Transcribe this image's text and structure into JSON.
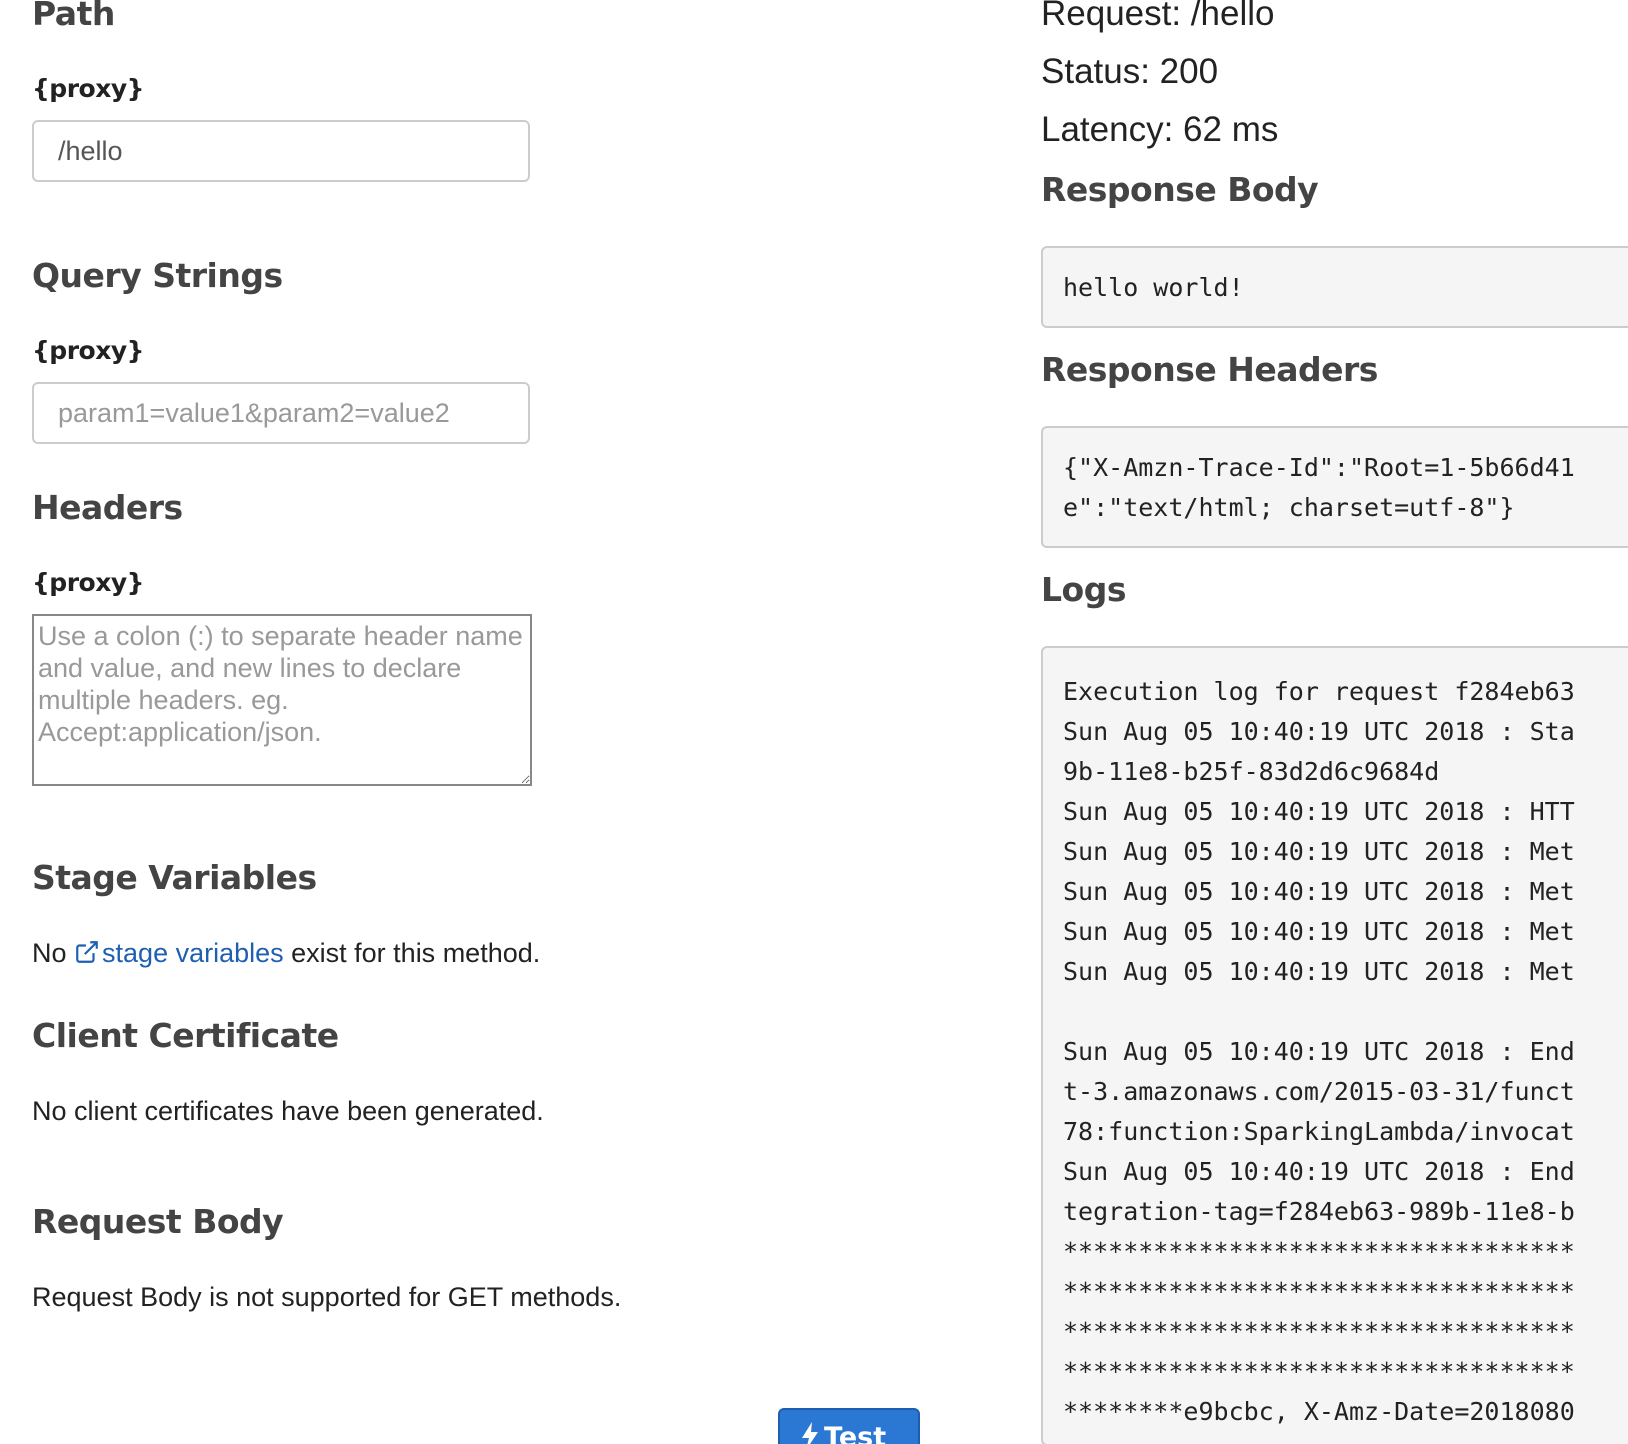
{
  "left": {
    "path": {
      "title": "Path",
      "param_label": "{proxy}",
      "value": "/hello"
    },
    "query_strings": {
      "title": "Query Strings",
      "param_label": "{proxy}",
      "placeholder": "param1=value1&param2=value2"
    },
    "headers": {
      "title": "Headers",
      "param_label": "{proxy}",
      "placeholder": "Use a colon (:) to separate header name and value, and new lines to declare multiple headers. eg. Accept:application/json."
    },
    "stage_variables": {
      "title": "Stage Variables",
      "prefix": "No ",
      "link_text": "stage variables",
      "suffix": " exist for this method."
    },
    "client_certificate": {
      "title": "Client Certificate",
      "text": "No client certificates have been generated."
    },
    "request_body": {
      "title": "Request Body",
      "text": "Request Body is not supported for GET methods."
    },
    "test_button": {
      "label": "Test"
    }
  },
  "right": {
    "request": "Request: /hello",
    "status": "Status: 200",
    "latency": "Latency: 62 ms",
    "response_body": {
      "title": "Response Body",
      "content": "hello world!"
    },
    "response_headers": {
      "title": "Response Headers",
      "content": "{\"X-Amzn-Trace-Id\":\"Root=1-5b66d41\ne\":\"text/html; charset=utf-8\"}"
    },
    "logs": {
      "title": "Logs",
      "content": "Execution log for request f284eb63\nSun Aug 05 10:40:19 UTC 2018 : Sta\n9b-11e8-b25f-83d2d6c9684d\nSun Aug 05 10:40:19 UTC 2018 : HTT\nSun Aug 05 10:40:19 UTC 2018 : Met\nSun Aug 05 10:40:19 UTC 2018 : Met\nSun Aug 05 10:40:19 UTC 2018 : Met\nSun Aug 05 10:40:19 UTC 2018 : Met\n\nSun Aug 05 10:40:19 UTC 2018 : End\nt-3.amazonaws.com/2015-03-31/funct\n78:function:SparkingLambda/invocat\nSun Aug 05 10:40:19 UTC 2018 : End\ntegration-tag=f284eb63-989b-11e8-b\n**********************************\n**********************************\n**********************************\n**********************************\n********e9bcbc, X-Amz-Date=2018080"
    }
  },
  "colors": {
    "link": "#1f5fb2",
    "button": "#2b78d4",
    "code_bg": "#f5f5f5"
  },
  "icons": {
    "external_link": "external-link-icon",
    "test": "bolt-icon"
  }
}
